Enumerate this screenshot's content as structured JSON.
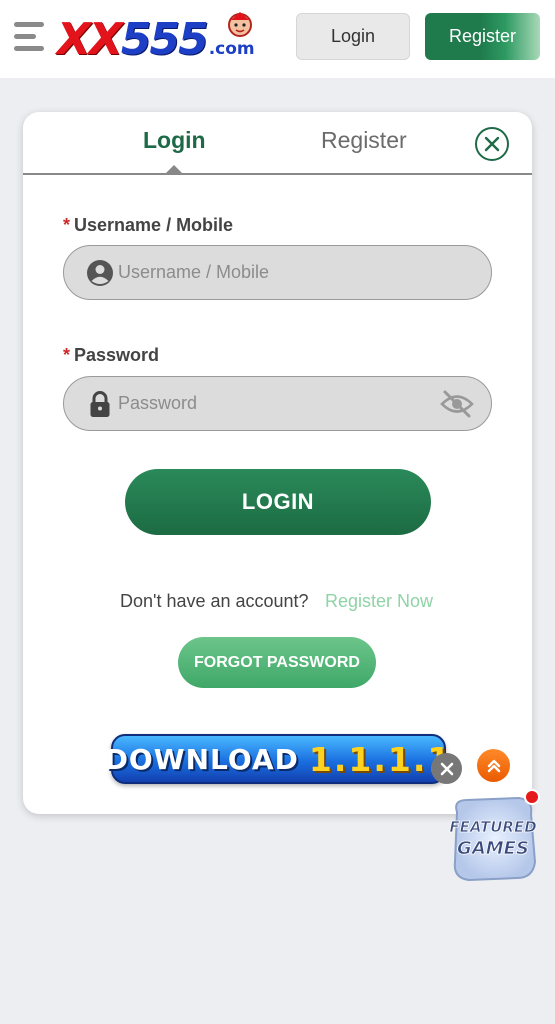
{
  "header": {
    "logo_xx": "XX",
    "logo_num": "555",
    "logo_com": ".com",
    "login_label": "Login",
    "register_label": "Register"
  },
  "tabs": {
    "login": "Login",
    "register": "Register"
  },
  "form": {
    "username": {
      "label": "Username / Mobile",
      "required_mark": "*",
      "placeholder": "Username / Mobile",
      "value": ""
    },
    "password": {
      "label": "Password",
      "required_mark": "*",
      "placeholder": "Password",
      "value": ""
    },
    "submit_label": "LOGIN",
    "no_account_text": "Don't have an account?",
    "register_now_label": "Register Now",
    "forgot_label": "FORGOT PASSWORD"
  },
  "download": {
    "label": "DOWNLOAD",
    "version": "1.1.1.1"
  },
  "featured": {
    "line1": "FEATURED",
    "line2": "GAMES"
  },
  "colors": {
    "brand_green": "#1e6a47",
    "accent_light_green": "#8fd3a6",
    "logo_red": "#e3131b",
    "logo_blue": "#1c3fc5",
    "required_red": "#cc2a2a"
  },
  "icons": {
    "menu": "menu-icon",
    "user": "user-icon",
    "lock": "lock-icon",
    "eye_off": "eye-off-icon",
    "close": "close-icon",
    "scroll_up": "double-chevron-up-icon"
  }
}
